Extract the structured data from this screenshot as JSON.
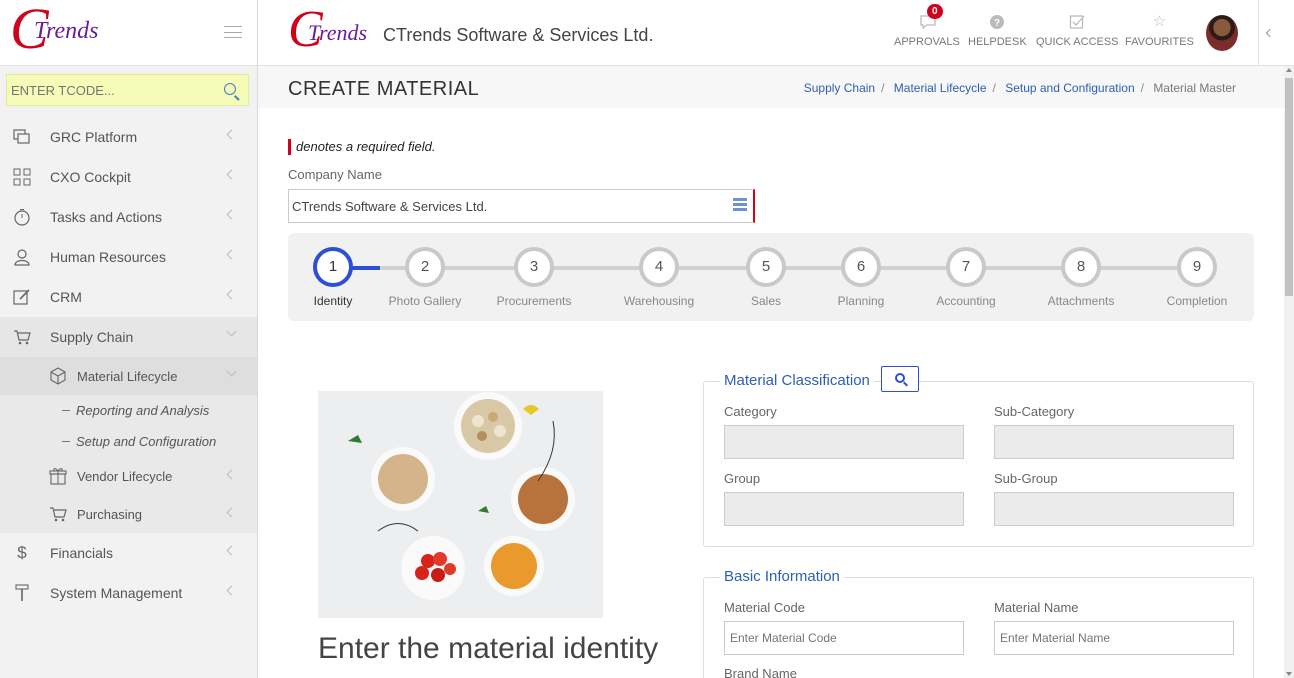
{
  "brand": {
    "logo_c": "C",
    "logo_text": "Trends",
    "company": "CTrends Software & Services Ltd."
  },
  "tcode": {
    "placeholder": "ENTER TCODE..."
  },
  "sidebar": {
    "items": [
      {
        "label": "GRC Platform",
        "icon": "layers-icon"
      },
      {
        "label": "CXO Cockpit",
        "icon": "grid-icon"
      },
      {
        "label": "Tasks and Actions",
        "icon": "stopwatch-icon"
      },
      {
        "label": "Human Resources",
        "icon": "user-icon"
      },
      {
        "label": "CRM",
        "icon": "edit-icon"
      },
      {
        "label": "Supply Chain",
        "icon": "cart-icon"
      },
      {
        "label": "Financials",
        "icon": "dollar-icon"
      },
      {
        "label": "System Management",
        "icon": "hammer-icon"
      }
    ],
    "supply_chain_sub": {
      "material_lifecycle": "Material Lifecycle",
      "reporting": "Reporting and Analysis",
      "setup": "Setup and Configuration",
      "vendor_lifecycle": "Vendor Lifecycle",
      "purchasing": "Purchasing"
    }
  },
  "header": {
    "approvals": "APPROVALS",
    "approvals_count": "0",
    "helpdesk": "HELPDESK",
    "quick_access": "QUICK ACCESS",
    "favourites": "FAVOURITES"
  },
  "page": {
    "title": "CREATE MATERIAL",
    "breadcrumb": [
      "Supply Chain",
      "Material Lifecycle",
      "Setup and Configuration",
      "Material Master"
    ],
    "required_note": "denotes a required field.",
    "company_label": "Company Name",
    "company_value": "CTrends Software & Services Ltd."
  },
  "steps": [
    {
      "num": "1",
      "label": "Identity"
    },
    {
      "num": "2",
      "label": "Photo Gallery"
    },
    {
      "num": "3",
      "label": "Procurements"
    },
    {
      "num": "4",
      "label": "Warehousing"
    },
    {
      "num": "5",
      "label": "Sales"
    },
    {
      "num": "6",
      "label": "Planning"
    },
    {
      "num": "7",
      "label": "Accounting"
    },
    {
      "num": "8",
      "label": "Attachments"
    },
    {
      "num": "9",
      "label": "Completion"
    }
  ],
  "intro_text": "Enter the material identity",
  "classification": {
    "title": "Material Classification",
    "category": "Category",
    "sub_category": "Sub-Category",
    "group": "Group",
    "sub_group": "Sub-Group"
  },
  "basic_info": {
    "title": "Basic Information",
    "code_label": "Material Code",
    "code_placeholder": "Enter Material Code",
    "name_label": "Material Name",
    "name_placeholder": "Enter Material Name",
    "brand_label": "Brand Name"
  }
}
